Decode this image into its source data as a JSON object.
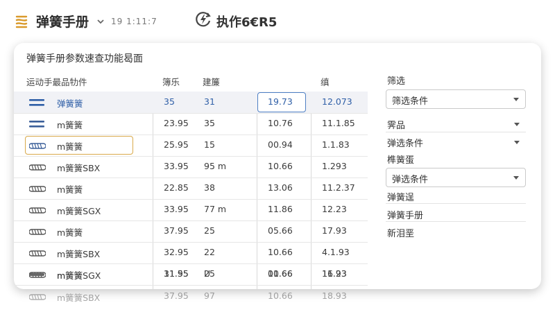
{
  "header": {
    "app_title": "弹簧手册",
    "time": "19 1:11:7",
    "exec_label": "执作6€R5"
  },
  "main": {
    "section_title": "弹簧手册参数速查功能曷面",
    "columns": [
      "运动手最品牞件",
      "簿乐",
      "建簾",
      "",
      "缜"
    ],
    "rows": [
      {
        "icon": "double-bar-icon",
        "name": "弹簧簧",
        "v1": "35",
        "v2": "31",
        "v3": "19.73",
        "v4": "12.073"
      },
      {
        "icon": "double-bar-icon",
        "name": "m簧簧",
        "v1": "23.95",
        "v2": "35",
        "v3": "10.76",
        "v4": "11.1.85"
      },
      {
        "icon": "coil-spring-icon",
        "name": "m簧簧",
        "v1": "25.95",
        "v2": "15",
        "v3": "00.94",
        "v4": "1.1.83"
      },
      {
        "icon": "coil-spring-icon",
        "name": "m簧簧SBX",
        "v1": "33.95",
        "v2": "95 m",
        "v3": "10.66",
        "v4": "1.293"
      },
      {
        "icon": "coil-spring-icon",
        "name": "m簧簧",
        "v1": "22.85",
        "v2": "38",
        "v3": "13.06",
        "v4": "11.2.37"
      },
      {
        "icon": "coil-spring-icon",
        "name": "m簧簧SGX",
        "v1": "33.95",
        "v2": "77 m",
        "v3": "11.86",
        "v4": "12.23"
      },
      {
        "icon": "coil-spring-icon",
        "name": "m簧簧",
        "v1": "37.95",
        "v2": "25",
        "v3": "05.66",
        "v4": "17.93"
      },
      {
        "icon": "coil-spring-icon",
        "name": "m簧簧SBX",
        "v1": "32.95",
        "v2": "22",
        "v3": "10.66",
        "v4": "4.1.93"
      },
      {
        "icon": "coil-spring-icon",
        "name": "m簧簧",
        "v1": "31.95",
        "v2": "25",
        "v3": "10.66",
        "v4": "16.93"
      },
      {
        "icon": "flat-bar-icon",
        "name": "m簧簧SGX",
        "v1": "11.55",
        "v2": "U",
        "v3": "01.66",
        "v4": "11.23"
      },
      {
        "icon": "coil-spring-icon",
        "name": "m簧簧SBX",
        "v1": "37.95",
        "v2": "97",
        "v3": "10.66",
        "v4": "18.93"
      }
    ]
  },
  "filters": {
    "title": "筛选",
    "select1": "筛选条件",
    "label_product": "霁品",
    "select2": "弹选条件",
    "label_a": "榫簧蛋",
    "select3": "弹选条件",
    "link1": "弹簧逞",
    "link2": "弹簧手册",
    "link3": "新泪垩"
  },
  "colors": {
    "accent_blue": "#2f5fa7",
    "selection_orange": "#d9a94a",
    "logo_gold": "#d99a2b"
  }
}
